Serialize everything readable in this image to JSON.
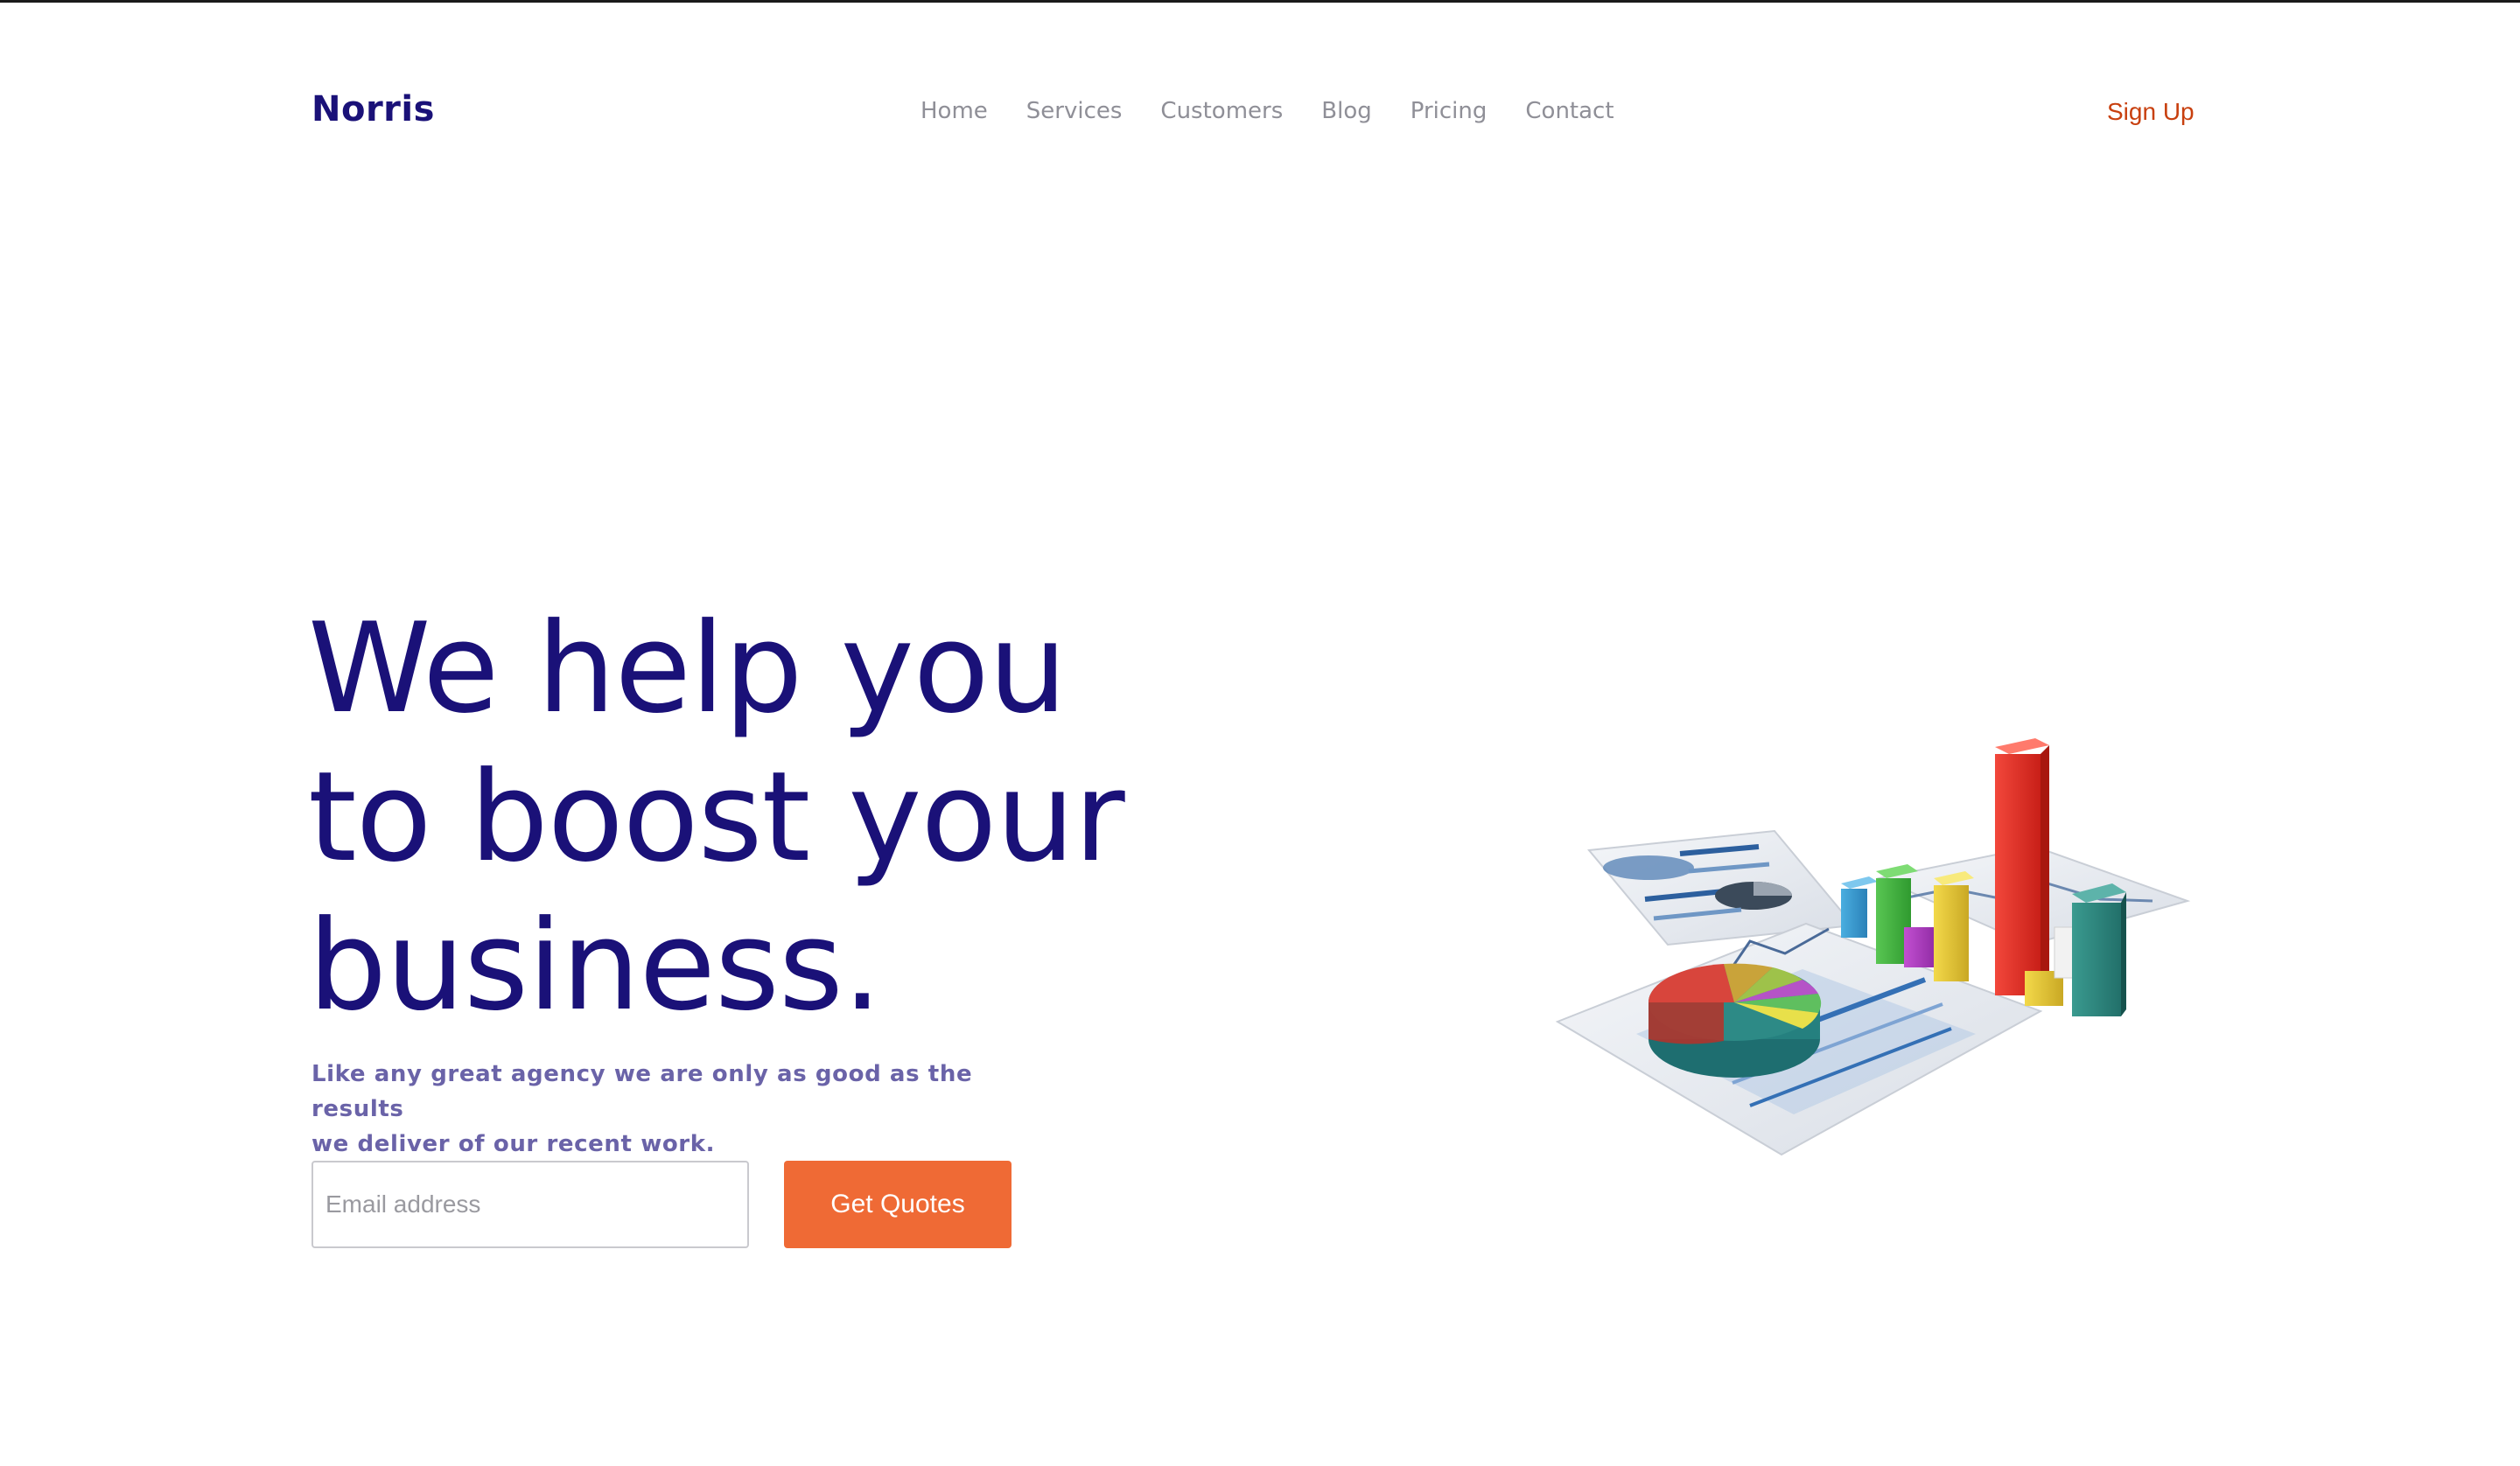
{
  "brand": {
    "name": "Norris"
  },
  "nav": {
    "items": [
      {
        "label": "Home"
      },
      {
        "label": "Services"
      },
      {
        "label": "Customers"
      },
      {
        "label": "Blog"
      },
      {
        "label": "Pricing"
      },
      {
        "label": "Contact"
      }
    ],
    "signup_label": "Sign Up"
  },
  "hero": {
    "title_lines": [
      "We help you",
      "to boost your",
      "business."
    ],
    "subtitle_lines": [
      "Like any great agency we are only as good as the results",
      "we deliver of our recent work."
    ],
    "email_placeholder": "Email address",
    "cta_label": "Get Quotes"
  },
  "colors": {
    "brand": "#1a1178",
    "nav_text": "#8f8f97",
    "signup": "#c8400f",
    "subtitle": "#6a63a8",
    "cta": "#ef6a35"
  },
  "illustration": {
    "icon": "business-charts-illustration"
  }
}
